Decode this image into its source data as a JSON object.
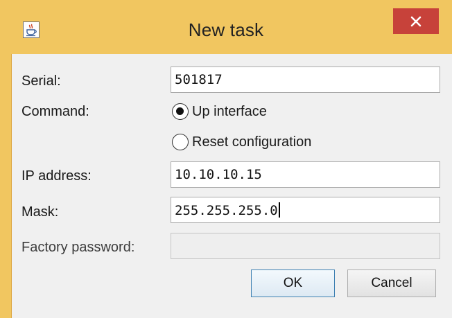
{
  "window": {
    "title": "New task",
    "icon": "java-cup-icon",
    "close_icon": "close-icon",
    "colors": {
      "frame": "#f1c660",
      "close": "#c7423a",
      "client": "#f0f0f0"
    }
  },
  "form": {
    "serial": {
      "label": "Serial:",
      "value": "501817"
    },
    "command": {
      "label": "Command:",
      "options": [
        {
          "label": "Up interface",
          "selected": true
        },
        {
          "label": "Reset configuration",
          "selected": false
        }
      ]
    },
    "ip_address": {
      "label": "IP address:",
      "value": "10.10.10.15"
    },
    "mask": {
      "label": "Mask:",
      "value": "255.255.255.0"
    },
    "factory_password": {
      "label": "Factory password:",
      "value": "",
      "disabled": true
    }
  },
  "buttons": {
    "ok_label": "OK",
    "cancel_label": "Cancel"
  }
}
